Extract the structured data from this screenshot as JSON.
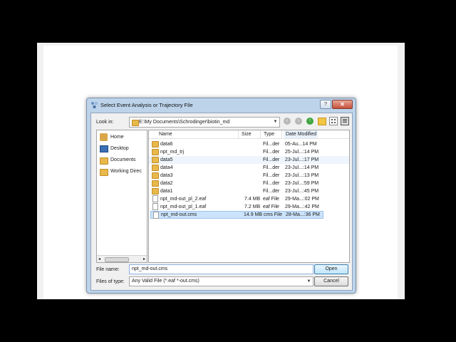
{
  "dialog": {
    "title": "Select Event Analysis or Trajectory File",
    "help_label": "?",
    "close_label": "✕"
  },
  "lookin": {
    "label": "Look in:",
    "path": "E:\\My Documents\\Schrodinger\\biotin_md"
  },
  "sidebar": {
    "items": [
      {
        "label": "Home",
        "icon": "home-icon"
      },
      {
        "label": "Desktop",
        "icon": "desktop-icon"
      },
      {
        "label": "Documents",
        "icon": "folder-icon"
      },
      {
        "label": "Working Direc",
        "icon": "folder-icon"
      }
    ]
  },
  "columns": {
    "name": "Name",
    "size": "Size",
    "type": "Type",
    "date": "Date Modified"
  },
  "files": [
    {
      "name": "data6",
      "size": "",
      "type": "Fil...der",
      "date": "05-Au...14 PM",
      "kind": "folder"
    },
    {
      "name": "npt_md_trj",
      "size": "",
      "type": "Fil...der",
      "date": "25-Jul...:14 PM",
      "kind": "folder"
    },
    {
      "name": "data5",
      "size": "",
      "type": "Fil...der",
      "date": "23-Jul...:17 PM",
      "kind": "folder"
    },
    {
      "name": "data4",
      "size": "",
      "type": "Fil...der",
      "date": "23-Jul...:14 PM",
      "kind": "folder"
    },
    {
      "name": "data3",
      "size": "",
      "type": "Fil...der",
      "date": "23-Jul...:13 PM",
      "kind": "folder"
    },
    {
      "name": "data2",
      "size": "",
      "type": "Fil...der",
      "date": "23-Jul...:59 PM",
      "kind": "folder"
    },
    {
      "name": "data1",
      "size": "",
      "type": "Fil...der",
      "date": "23-Jul...:45 PM",
      "kind": "folder"
    },
    {
      "name": "npt_md-out_pl_2.eaf",
      "size": "7.4 MB",
      "type": "eaf File",
      "date": "29-Ma...:02 PM",
      "kind": "file"
    },
    {
      "name": "npt_md-out_pl_1.eaf",
      "size": "7.2 MB",
      "type": "eaf File",
      "date": "29-Ma...:42 PM",
      "kind": "file"
    },
    {
      "name": "npt_md-out.cms",
      "size": "14.9 MB",
      "type": "cms File",
      "date": "28-Ma...:36 PM",
      "kind": "file"
    }
  ],
  "filename": {
    "label": "File name:",
    "value": "npt_md-out.cms"
  },
  "filetype": {
    "label": "Files of type:",
    "value": "Any Valid File (*.eaf *-out.cms)"
  },
  "buttons": {
    "open": "Open",
    "cancel": "Cancel"
  },
  "colors": {
    "selection": "#cce3fb",
    "titlebar": "#bcd3ea",
    "close": "#c5503b"
  }
}
